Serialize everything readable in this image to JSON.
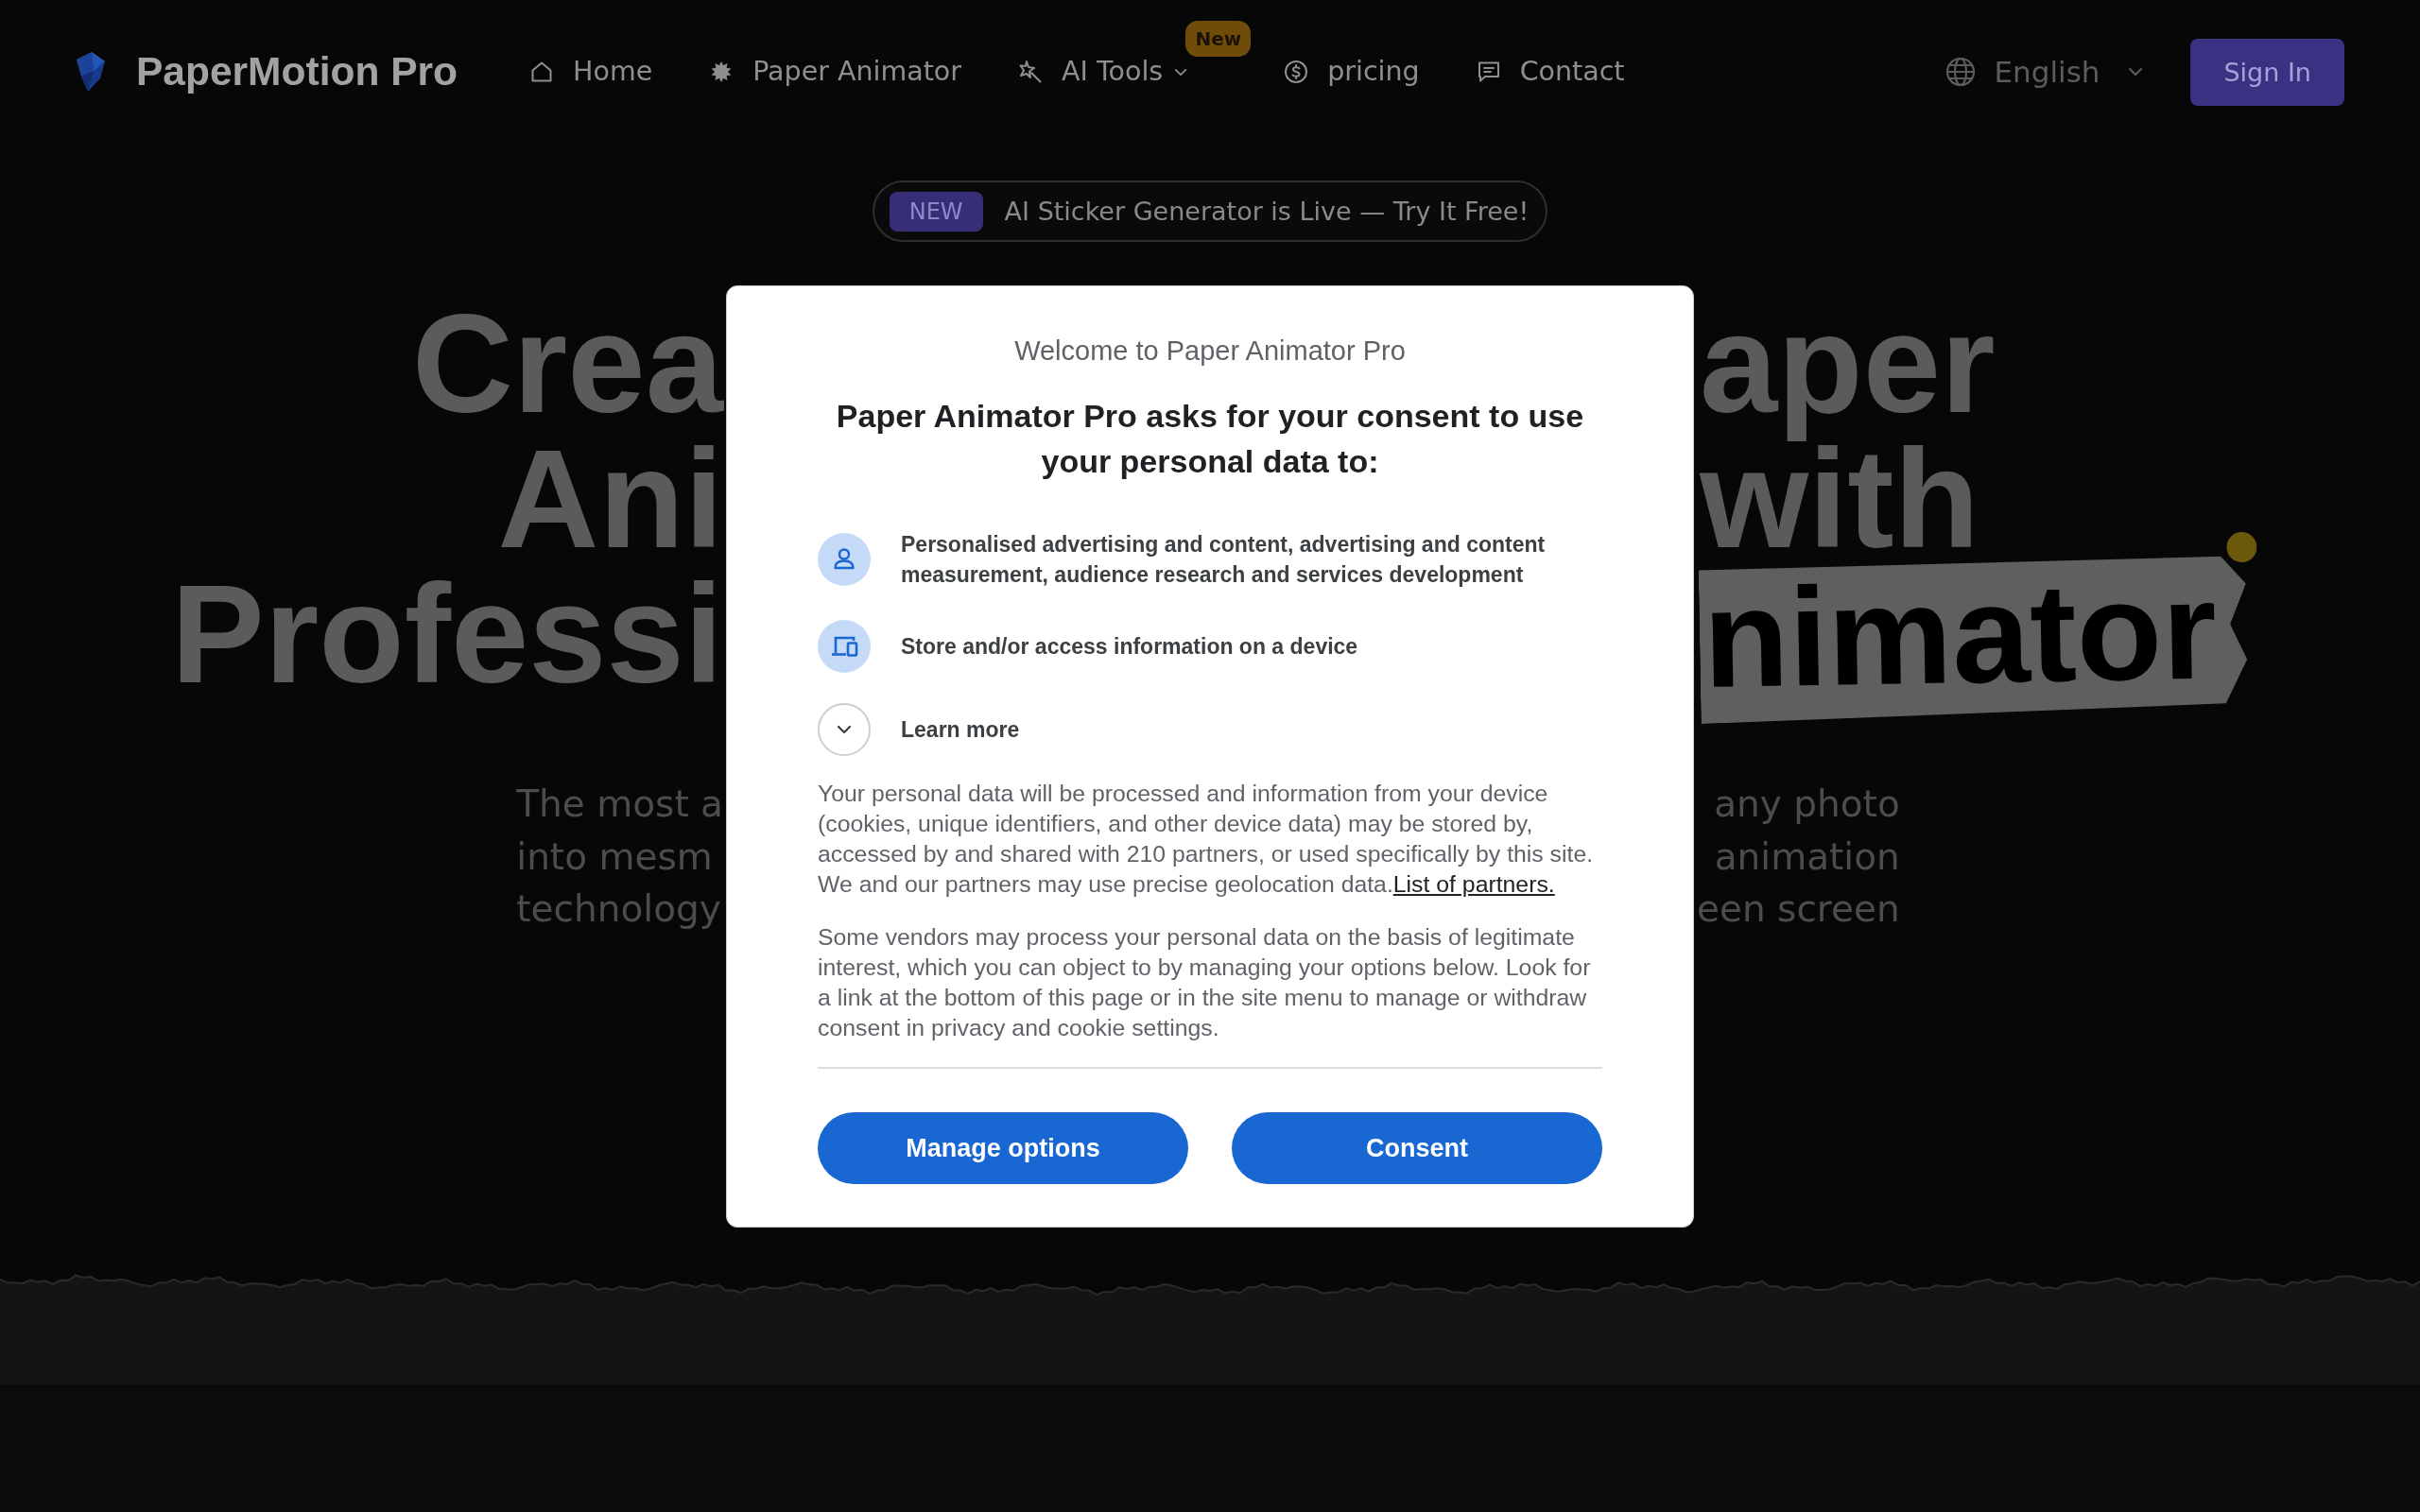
{
  "nav": {
    "logo_text": "PaperMotion Pro",
    "items": [
      {
        "label": "Home",
        "has_menu": false
      },
      {
        "label": "Paper Animator",
        "has_menu": false
      },
      {
        "label": "AI Tools",
        "has_menu": true,
        "badge": "New"
      },
      {
        "label": "pricing",
        "has_menu": false
      },
      {
        "label": "Contact",
        "has_menu": false
      }
    ],
    "language": "English",
    "sign_in": "Sign In"
  },
  "announcement": {
    "tag": "NEW",
    "text": "AI Sticker Generator is Live — Try It Free!"
  },
  "hero": {
    "headline_lines": [
      {
        "left": "Crea",
        "right": "aper",
        "highlighted": false
      },
      {
        "left": "Ani",
        "right": "with",
        "highlighted": false
      },
      {
        "left": "Professi",
        "right": "nimator",
        "highlighted": true
      }
    ],
    "subtitle_lines": [
      {
        "left": "The most a",
        "right": "any photo"
      },
      {
        "left": "into mesm",
        "right": "animation"
      },
      {
        "left": "technology",
        "right": "een screen"
      }
    ]
  },
  "consent_dialog": {
    "title": "Welcome to Paper Animator Pro",
    "heading": "Paper Animator Pro asks for your consent to use your personal data to:",
    "purposes": [
      {
        "text": "Personalised advertising and content, advertising and content measurement, audience research and services development"
      },
      {
        "text": "Store and/or access information on a device"
      }
    ],
    "learn_more": {
      "label": "Learn more",
      "expanded": false
    },
    "paragraphs": [
      {
        "text": "Your personal data will be processed and information from your device (cookies, unique identifiers, and other device data) may be stored by, accessed by and shared with 210 partners, or used specifically by this site. We and our partners may use precise geolocation data.",
        "link": "List of partners."
      },
      {
        "text": "Some vendors may process your personal data on the basis of legitimate interest, which you can object to by managing your options below. Look for a link at the bottom of this page or in the site menu to manage or withdraw consent in privacy and cookie settings."
      }
    ],
    "buttons": [
      "Manage options",
      "Consent"
    ]
  }
}
